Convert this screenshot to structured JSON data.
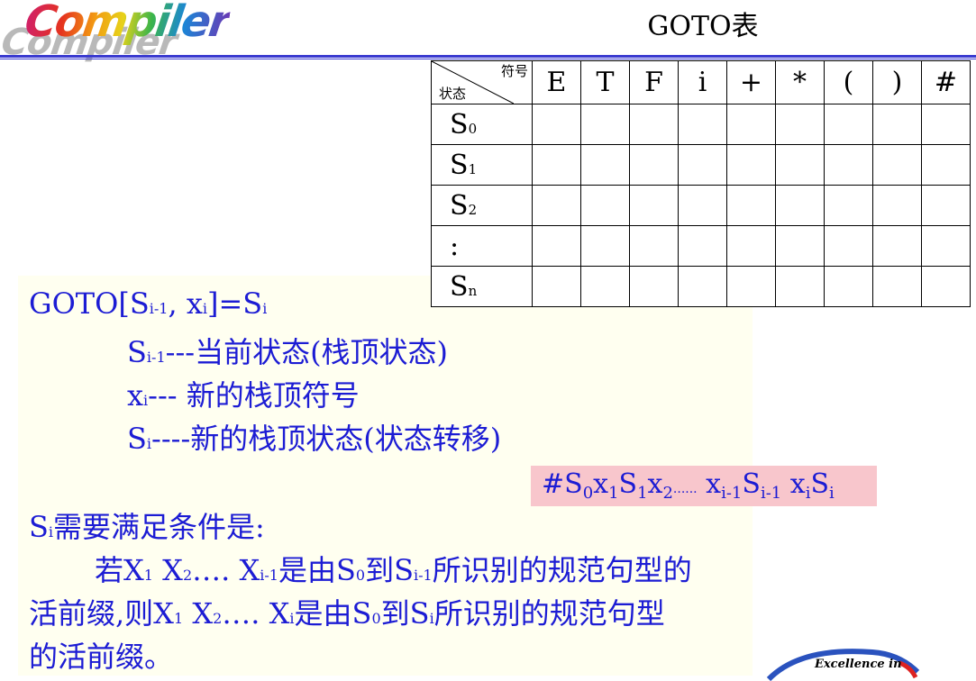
{
  "header": {
    "logo_text": "Compiler",
    "title": "GOTO表"
  },
  "table": {
    "corner_symbol": "符号",
    "corner_state": "状态",
    "columns": [
      "E",
      "T",
      "F",
      "i",
      "+",
      "*",
      "(",
      ")",
      "#"
    ],
    "rows": [
      {
        "base": "S",
        "sub": "0"
      },
      {
        "base": "S",
        "sub": "1"
      },
      {
        "base": "S",
        "sub": "2"
      },
      {
        "base": ":",
        "sub": ""
      },
      {
        "base": "S",
        "sub": "n"
      }
    ]
  },
  "definition": {
    "l1_a": "GOTO[S",
    "l1_b": "i-1",
    "l1_c": ", x",
    "l1_d": "i",
    "l1_e": "]=S",
    "l1_f": "i",
    "l2_a": "S",
    "l2_b": "i-1",
    "l2_c": "---当前状态(栈顶状态)",
    "l3_a": "x",
    "l3_b": "i",
    "l3_c": "--- 新的栈顶符号",
    "l4_a": "S",
    "l4_b": "i",
    "l4_c": "----新的栈顶状态(状态转移)"
  },
  "formula": {
    "p1": "#S",
    "s1": "0",
    "p2": "x",
    "s2": "1",
    "p3": "S",
    "s3": "1",
    "p4": "x",
    "s4": "2",
    "dots": "......",
    "p5": " x",
    "s5": "i-1",
    "p6": "S",
    "s6": "i-1",
    "p7": " x",
    "s7": "i",
    "p8": "S",
    "s8": "i"
  },
  "condition": {
    "c1_a": "S",
    "c1_b": "i",
    "c1_c": "需要满足条件是:",
    "c2_a": "若X",
    "c2_b": "1",
    "c2_c": " X",
    "c2_d": "2",
    "c2_e": "…. X",
    "c2_f": "i-1",
    "c2_g": "是由S",
    "c2_h": "0",
    "c2_i": "到S",
    "c2_j": "i-1",
    "c2_k": "所识别的规范句型的",
    "c3_a": "活前缀,则X",
    "c3_b": "1",
    "c3_c": " X",
    "c3_d": "2",
    "c3_e": "…. X",
    "c3_f": "i",
    "c3_g": "是由S",
    "c3_h": "0",
    "c3_i": "到S",
    "c3_j": "i",
    "c3_k": "所识别的规范句型",
    "c4": "的活前缀。"
  },
  "badge": {
    "text": "Excellence in"
  },
  "colors": {
    "text_blue": "#1c1cd4",
    "rule": "#3a3ad0",
    "note_bg": "#fffff0",
    "formula_bg": "#f8c6cc"
  }
}
